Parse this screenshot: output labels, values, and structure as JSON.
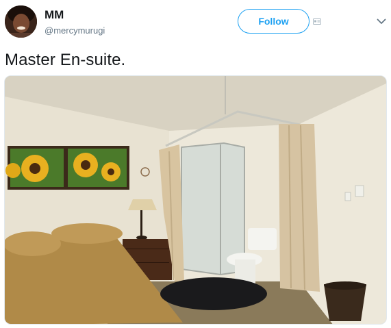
{
  "user": {
    "name": "MM",
    "handle": "@mercymurugi"
  },
  "actions": {
    "follow_label": "Follow"
  },
  "tweet": {
    "text": "Master En-suite."
  },
  "icons": {
    "follow_extra": "contact-card-icon",
    "more": "chevron-down-icon"
  },
  "colors": {
    "accent": "#1da1f2",
    "secondary_text": "#657786",
    "primary_text": "#14171a"
  }
}
